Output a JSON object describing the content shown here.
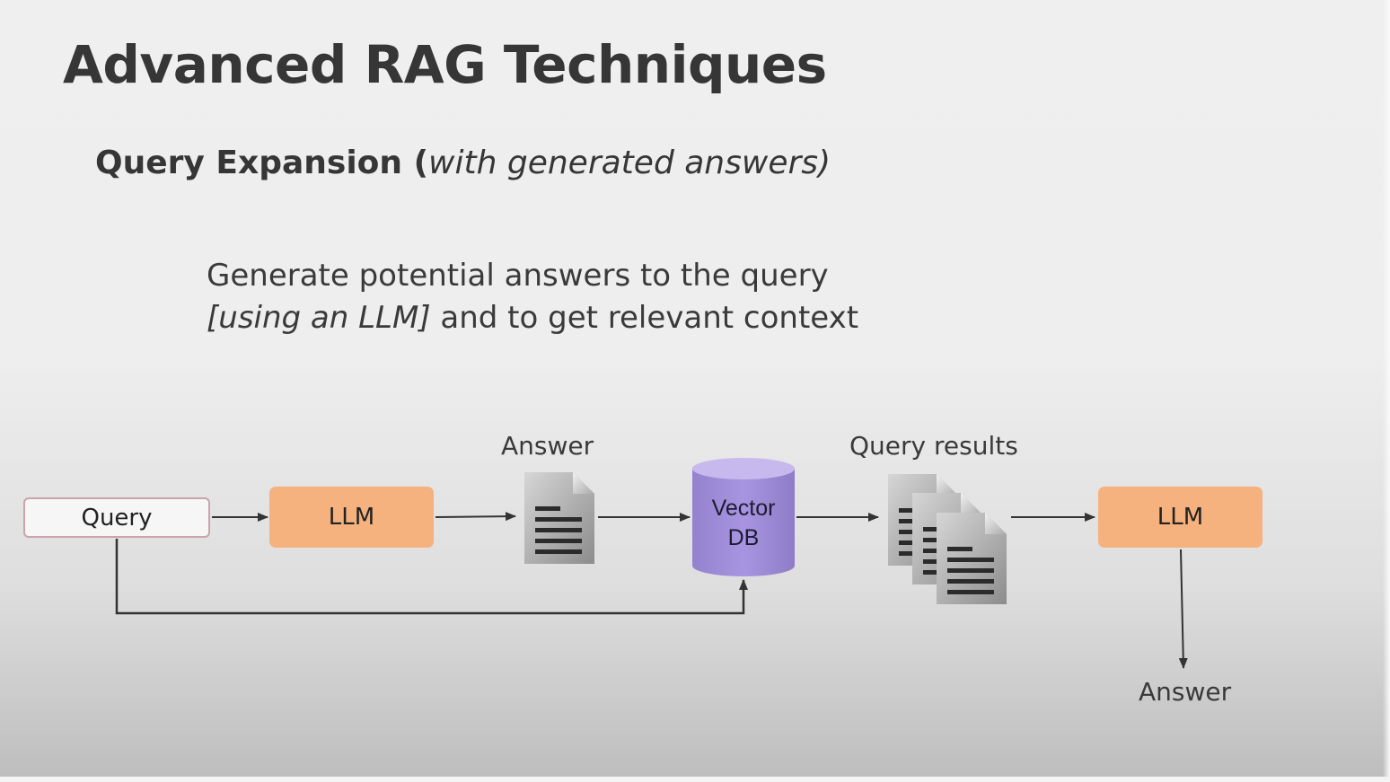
{
  "slide": {
    "title": "Advanced RAG Techniques",
    "subtitle": {
      "bold": "Query Expansion (",
      "italic": "with generated answers)"
    },
    "description": {
      "line1": "Generate potential answers to the query",
      "line2_italic": "[using an LLM]",
      "line2_rest": " and to get relevant context"
    }
  },
  "diagram": {
    "query": "Query",
    "llm_first": "LLM",
    "answer_label": "Answer",
    "vector_db_line1": "Vector",
    "vector_db_line2": "DB",
    "query_results_label": "Query results",
    "llm_second": "LLM",
    "final_answer_label": "Answer",
    "icons": [
      "document-icon",
      "documents-stack-icon",
      "database-cylinder-icon"
    ],
    "colors": {
      "llm_fill": "#f5b27e",
      "db_fill": "#9d8bd4",
      "query_border": "#c9a4aa",
      "arrow": "#333333"
    }
  }
}
